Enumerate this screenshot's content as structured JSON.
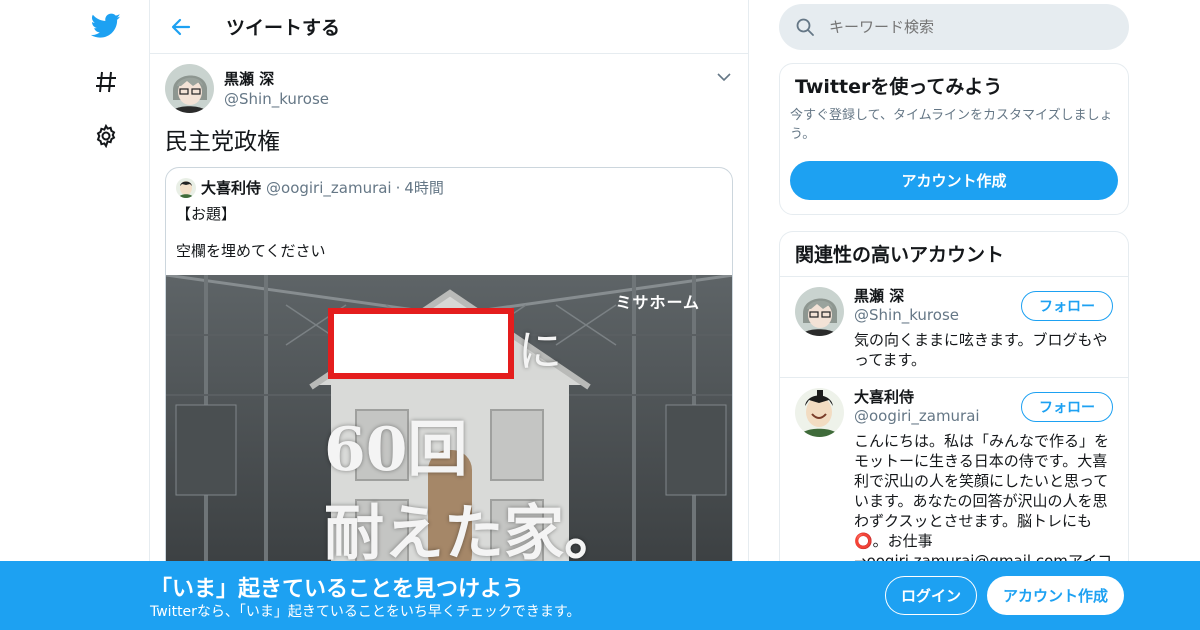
{
  "colors": {
    "accent": "#1da1f2",
    "border": "#e6ecf0",
    "muted": "#657786",
    "red_box": "#e41d1d"
  },
  "nav": {
    "logo_icon": "twitter-bird-icon",
    "explore_icon": "hashtag-icon",
    "settings_icon": "gear-icon"
  },
  "header": {
    "back_icon": "back-arrow-icon",
    "title": "ツイートする"
  },
  "tweet": {
    "author_name": "黒瀬 深",
    "author_handle": "@Shin_kurose",
    "text": "民主党政権",
    "quote": {
      "name": "大喜利侍",
      "handle": "@oogiri_zamurai",
      "dot": "·",
      "time": "4時間",
      "line1": "【お題】",
      "line2": "空欄を埋めてください",
      "media": {
        "logo_text": "ミサホーム",
        "text_ni": "に",
        "text_60": "60回",
        "text_tae": "耐えた家。"
      }
    }
  },
  "search": {
    "placeholder": "キーワード検索"
  },
  "signup_card": {
    "title": "Twitterを使ってみよう",
    "desc": "今すぐ登録して、タイムラインをカスタマイズしましょう。",
    "button": "アカウント作成"
  },
  "related": {
    "title": "関連性の高いアカウント",
    "accounts": [
      {
        "name": "黒瀬 深",
        "handle": "@Shin_kurose",
        "bio": "気の向くままに呟きます。ブログもやってます。",
        "follow": "フォロー"
      },
      {
        "name": "大喜利侍",
        "handle": "@oogiri_zamurai",
        "bio": "こんにちは。私は「みんなで作る」をモットーに生きる日本の侍です。大喜利で沢山の人を笑顔にしたいと思っています。あなたの回答が沢山の人を思わずクスッとさせます。脳トレにも⭕。お仕事→oogiri.zamurai@gmail.comアイコン:",
        "follow": "フォロー"
      }
    ]
  },
  "banner": {
    "title": "「いま」起きていることを見つけよう",
    "subtitle": "Twitterなら、「いま」起きていることをいち早くチェックできます。",
    "login": "ログイン",
    "signup": "アカウント作成"
  }
}
